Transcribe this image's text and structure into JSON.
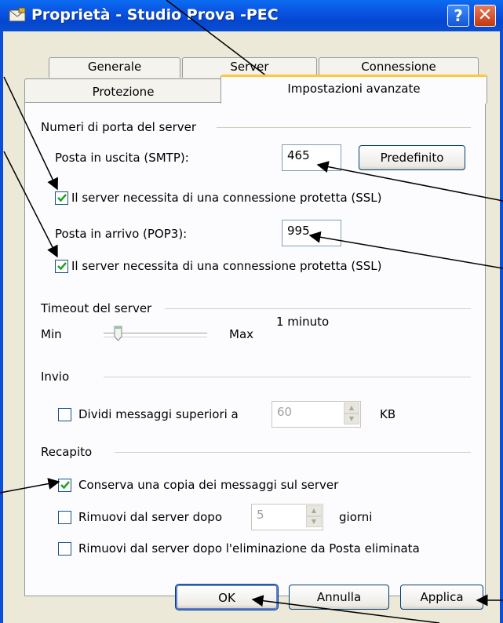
{
  "window": {
    "title": "Proprietà - Studio Prova -PEC",
    "help_label": "?",
    "close_label": "✕"
  },
  "tabs": {
    "row1": [
      "Generale",
      "Server",
      "Connessione"
    ],
    "row2": [
      "Protezione",
      "Impostazioni avanzate"
    ],
    "active": "Impostazioni avanzate"
  },
  "ports": {
    "group_title": "Numeri di porta del server",
    "smtp_label": "Posta in uscita (SMTP):",
    "smtp_value": "465",
    "default_button": "Predefinito",
    "smtp_ssl_label": "Il server necessita di una connessione protetta (SSL)",
    "smtp_ssl_checked": true,
    "pop3_label": "Posta in arrivo (POP3):",
    "pop3_value": "995",
    "pop3_ssl_label": "Il server necessita di una connessione protetta (SSL)",
    "pop3_ssl_checked": true
  },
  "timeout": {
    "group_title": "Timeout del server",
    "min_label": "Min",
    "max_label": "Max",
    "value_label": "1 minuto",
    "slider_level": 0.1
  },
  "send": {
    "group_title": "Invio",
    "split_label": "Dividi messaggi superiori a",
    "split_checked": false,
    "split_value": "60",
    "unit_label": "KB"
  },
  "delivery": {
    "group_title": "Recapito",
    "keep_copy_label": "Conserva una copia dei messaggi sul server",
    "keep_copy_checked": true,
    "remove_after_label": "Rimuovi dal server dopo",
    "remove_after_checked": false,
    "remove_after_value": "5",
    "days_label": "giorni",
    "remove_deleted_label": "Rimuovi dal server dopo l'eliminazione da Posta eliminata",
    "remove_deleted_checked": false
  },
  "footer": {
    "ok_label": "OK",
    "cancel_label": "Annulla",
    "apply_label": "Applica"
  },
  "colors": {
    "titlebar": "#0a55e3",
    "client": "#ece9d8",
    "check_green": "#21a121",
    "active_tab_accent": "#ffc83c"
  }
}
